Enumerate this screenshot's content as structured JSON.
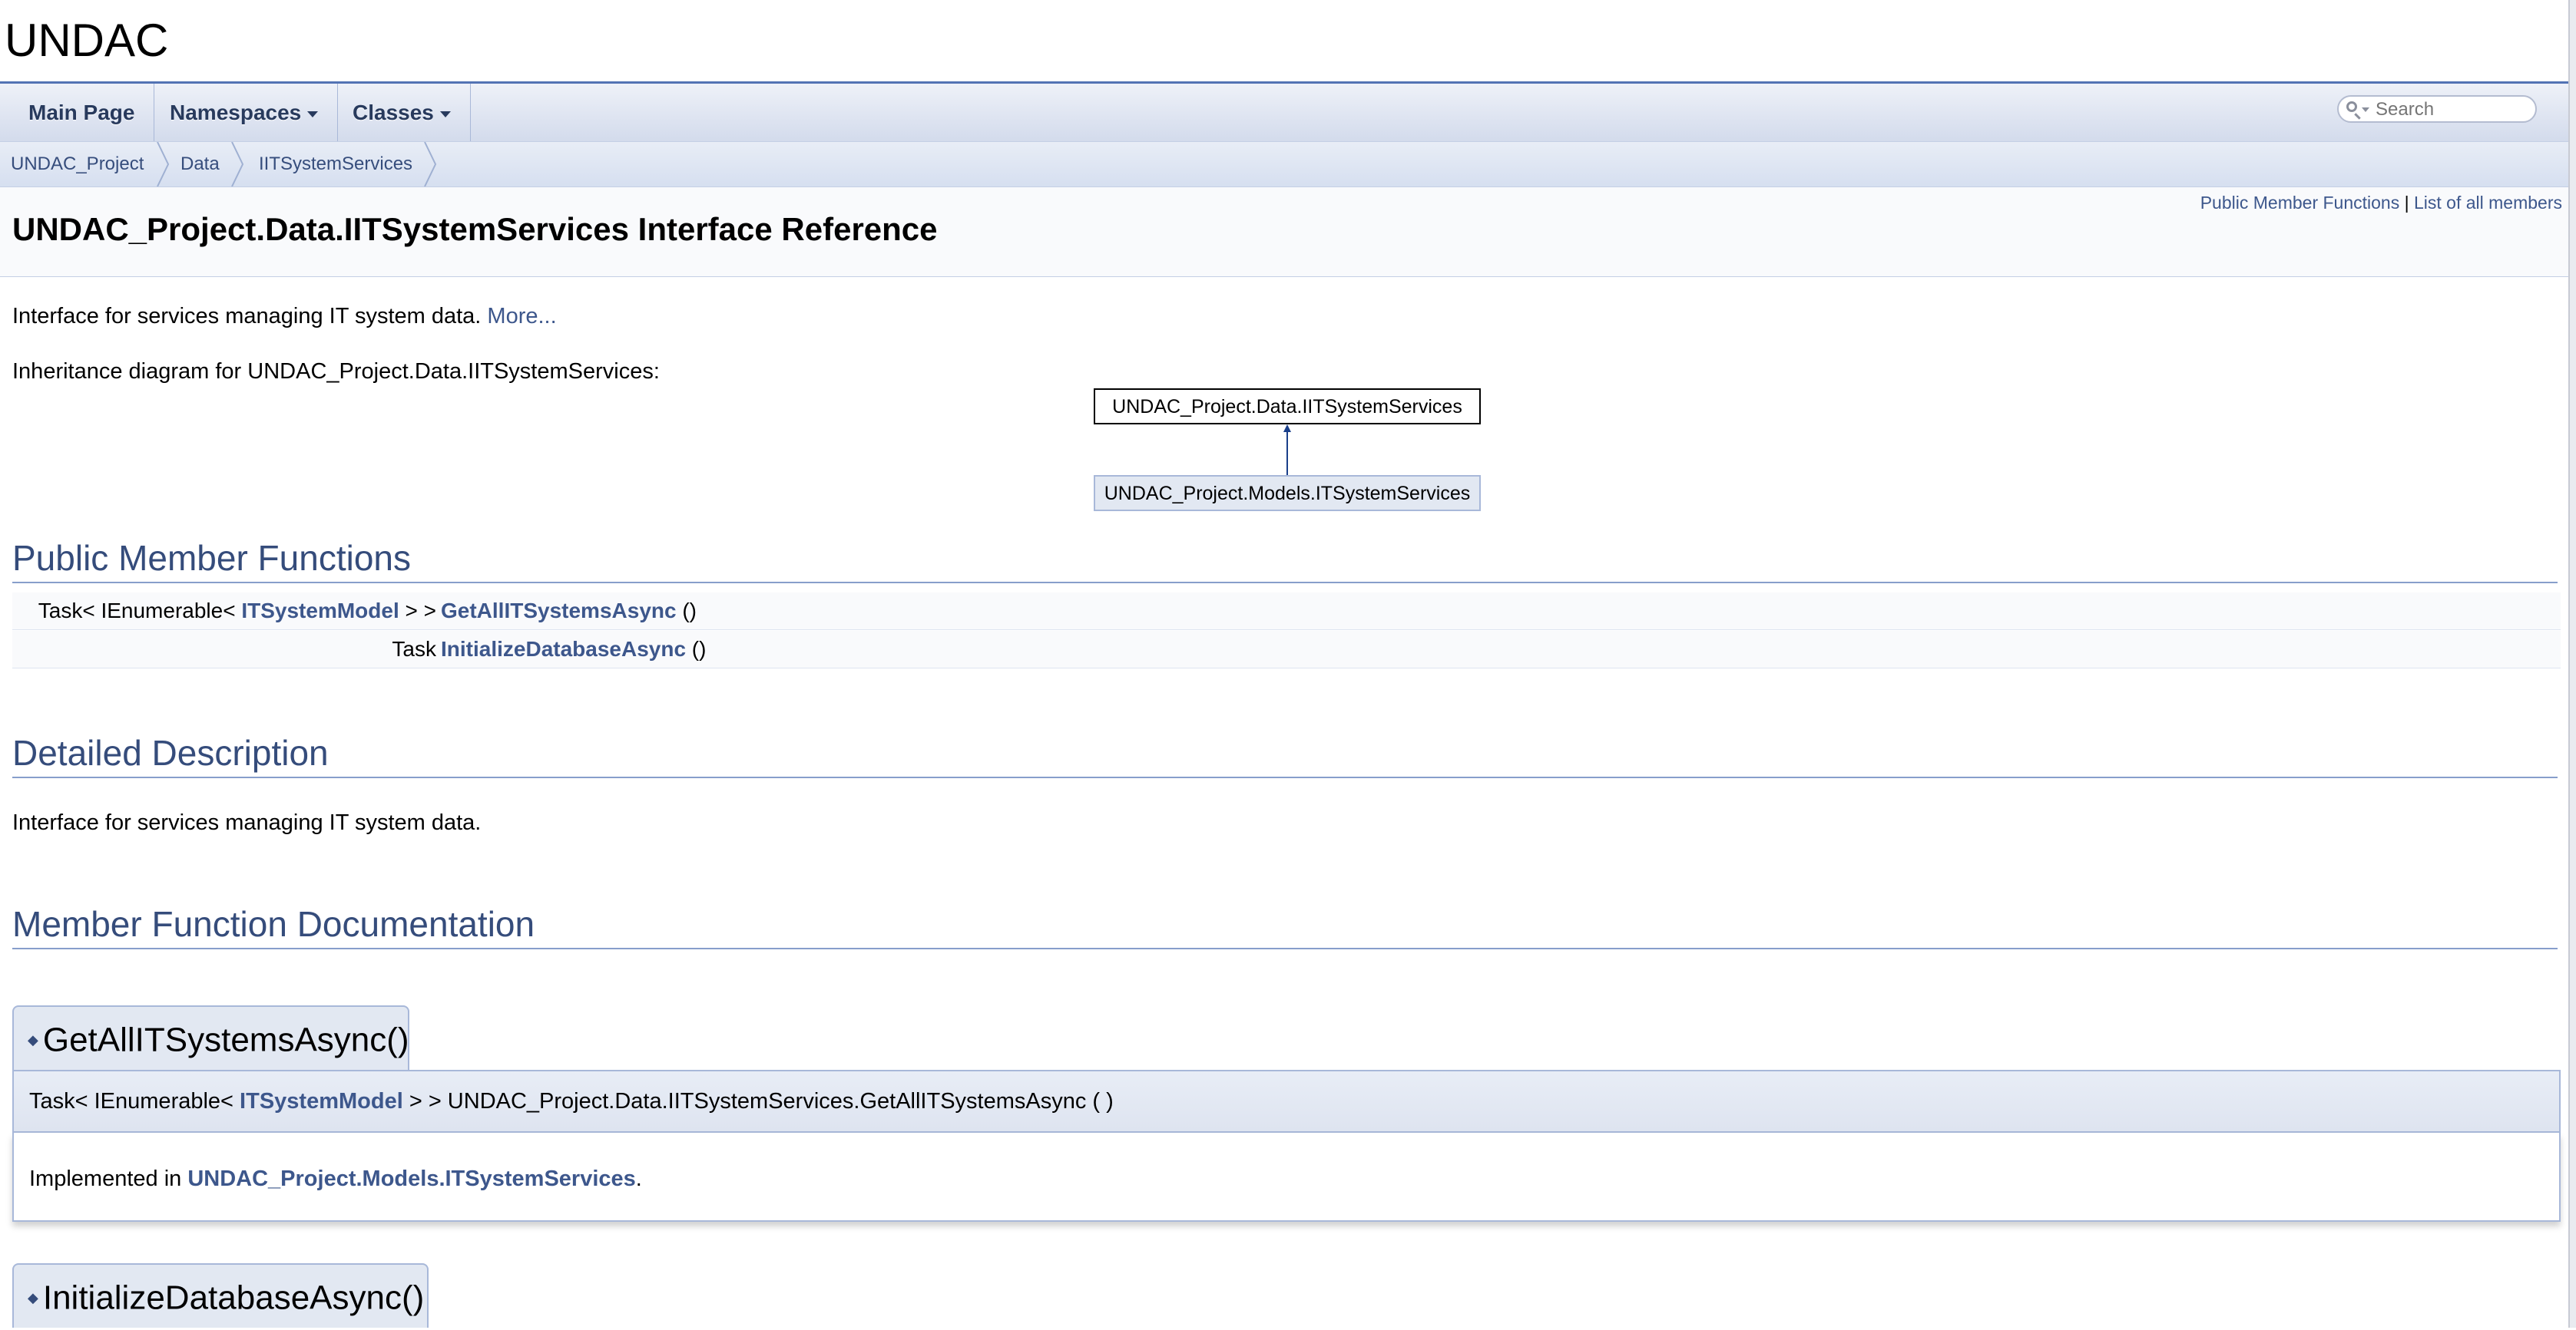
{
  "project": {
    "name": "UNDAC"
  },
  "nav": {
    "items": [
      "Main Page",
      "Namespaces",
      "Classes"
    ],
    "search_placeholder": "Search"
  },
  "breadcrumb": [
    "UNDAC_Project",
    "Data",
    "IITSystemServices"
  ],
  "summary": {
    "public_member_functions": "Public Member Functions",
    "separator": "|",
    "list_all_members": "List of all members"
  },
  "title": "UNDAC_Project.Data.IITSystemServices Interface Reference",
  "brief": {
    "text": "Interface for services managing IT system data.",
    "more": "More..."
  },
  "inheritance": {
    "label": "Inheritance diagram for UNDAC_Project.Data.IITSystemServices:",
    "base": "UNDAC_Project.Data.IITSystemServices",
    "derived": "UNDAC_Project.Models.ITSystemServices"
  },
  "public_member_functions": {
    "heading": "Public Member Functions",
    "rows": [
      {
        "type_pre": "Task< IEnumerable< ",
        "type_link": "ITSystemModel",
        "type_post": " > >",
        "name": "GetAllITSystemsAsync",
        "args": " ()"
      },
      {
        "type_pre": "Task",
        "type_link": "",
        "type_post": "",
        "name": "InitializeDatabaseAsync",
        "args": " ()"
      }
    ]
  },
  "detailed_description": {
    "heading": "Detailed Description",
    "text": "Interface for services managing IT system data."
  },
  "member_function_docs": {
    "heading": "Member Function Documentation",
    "items": [
      {
        "tab": "GetAllITSystemsAsync()",
        "proto_pre": "Task< IEnumerable< ",
        "proto_link": "ITSystemModel",
        "proto_post": " > > UNDAC_Project.Data.IITSystemServices.GetAllITSystemsAsync (  )",
        "impl_pre": "Implemented in ",
        "impl_link": "UNDAC_Project.Models.ITSystemServices",
        "impl_post": "."
      },
      {
        "tab": "InitializeDatabaseAsync()"
      }
    ]
  },
  "colors": {
    "link": "#3d578c",
    "heading": "#354c7b",
    "border": "#a8b8d9"
  }
}
